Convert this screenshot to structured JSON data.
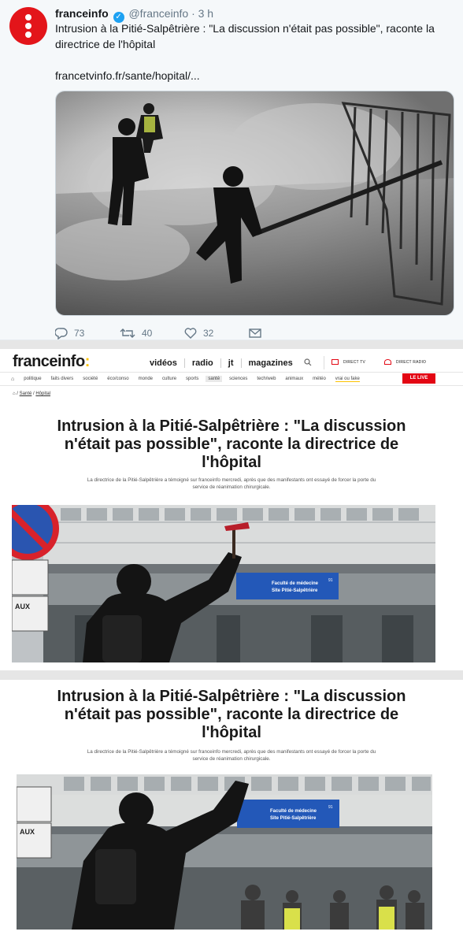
{
  "tweet": {
    "name": "franceinfo",
    "handle": "@franceinfo",
    "separator": "·",
    "time": "3 h",
    "text": "Intrusion à la Pitié-Salpêtrière : \"La discussion n'était pas possible\", raconte la directrice de l'hôpital",
    "link": "francetvinfo.fr/sante/hopital/...",
    "replies": "73",
    "retweets": "40",
    "likes": "32"
  },
  "site": {
    "logo_text": "franceinfo",
    "logo_colon": ":",
    "nav": [
      "vidéos",
      "radio",
      "jt",
      "magazines"
    ],
    "direct_tv": "DIRECT TV",
    "direct_radio": "DIRECT RADIO",
    "categories": [
      "politique",
      "faits divers",
      "société",
      "éco/conso",
      "monde",
      "culture",
      "sports",
      "santé",
      "sciences",
      "tech/web",
      "animaux",
      "météo",
      "vrai ou fake"
    ],
    "live_label": "LE LIVE",
    "breadcrumb": [
      "Santé",
      "Hôpital"
    ],
    "breadcrumb_sep": "/"
  },
  "article_1": {
    "title": "Intrusion à la Pitié-Salpêtrière : \"La discussion n'était pas possible\", raconte la directrice de l'hôpital",
    "lead": "La directrice de la Pitié-Salpêtrière a témoigné sur franceinfo mercredi, après que des manifestants ont essayé de forcer la porte du service de réanimation chirurgicale.",
    "sign_line1": "Faculté de médecine",
    "sign_line2": "Site Pitié-Salpêtrière",
    "sign_num": "91",
    "street_sign": "AUX"
  },
  "article_2": {
    "title": "Intrusion à la Pitié-Salpêtrière : \"La discussion n'était pas possible\", raconte la directrice de l'hôpital",
    "lead": "La directrice de la Pitié-Salpêtrière a témoigné sur franceinfo mercredi, après que des manifestants ont essayé de forcer la porte du service de réanimation chirurgicale.",
    "sign_line1": "Faculté de médecine",
    "sign_line2": "Site Pitié-Salpêtrière",
    "sign_num": "91",
    "street_sign": "AUX"
  },
  "colors": {
    "brand_red": "#e30613",
    "brand_yellow": "#fcc300",
    "twitter_blue": "#1da1f2"
  }
}
